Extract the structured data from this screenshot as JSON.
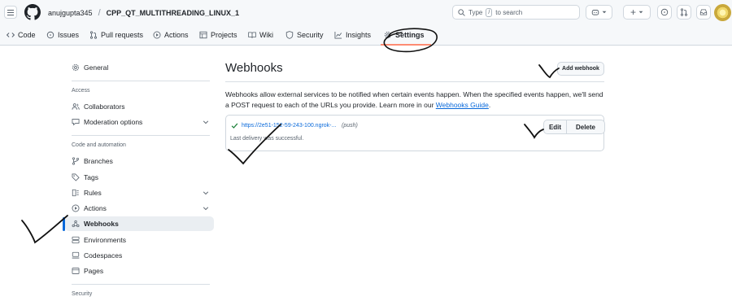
{
  "header": {
    "owner": "anujgupta345",
    "separator": "/",
    "repo": "CPP_QT_MULTITHREADING_LINUX_1",
    "search": {
      "prefix": "Type",
      "key": "/",
      "suffix": "to search"
    },
    "buttons": {
      "new": "+"
    }
  },
  "tabs": [
    {
      "label": "Code",
      "icon": "code-icon"
    },
    {
      "label": "Issues",
      "icon": "issue-icon"
    },
    {
      "label": "Pull requests",
      "icon": "pull-request-icon"
    },
    {
      "label": "Actions",
      "icon": "play-icon"
    },
    {
      "label": "Projects",
      "icon": "table-icon"
    },
    {
      "label": "Wiki",
      "icon": "book-icon"
    },
    {
      "label": "Security",
      "icon": "shield-icon"
    },
    {
      "label": "Insights",
      "icon": "graph-icon"
    },
    {
      "label": "Settings",
      "icon": "gear-icon",
      "selected": true
    }
  ],
  "sidebar": {
    "general": "General",
    "sections": {
      "access": "Access",
      "code_automation": "Code and automation",
      "security": "Security"
    },
    "items": {
      "collaborators": "Collaborators",
      "moderation": "Moderation options",
      "branches": "Branches",
      "tags": "Tags",
      "rules": "Rules",
      "actions": "Actions",
      "webhooks": "Webhooks",
      "environments": "Environments",
      "codespaces": "Codespaces",
      "pages": "Pages"
    },
    "active": "webhooks"
  },
  "main": {
    "title": "Webhooks",
    "add_button": "Add webhook",
    "description": "Webhooks allow external services to be notified when certain events happen. When the specified events happen, we'll send a POST request to each of the URLs you provide. Learn more in our",
    "guide_link": "Webhooks Guide",
    "description_end": ".",
    "hook": {
      "url": "https://2e51-152-59-243-100.ngrok-...",
      "events": "(push)",
      "status": "Last delivery was successful.",
      "edit": "Edit",
      "delete": "Delete"
    }
  },
  "colors": {
    "accent": "#0969da",
    "tab_underline": "#fd8c73",
    "success": "#1a7f37",
    "ink": "#111111"
  }
}
